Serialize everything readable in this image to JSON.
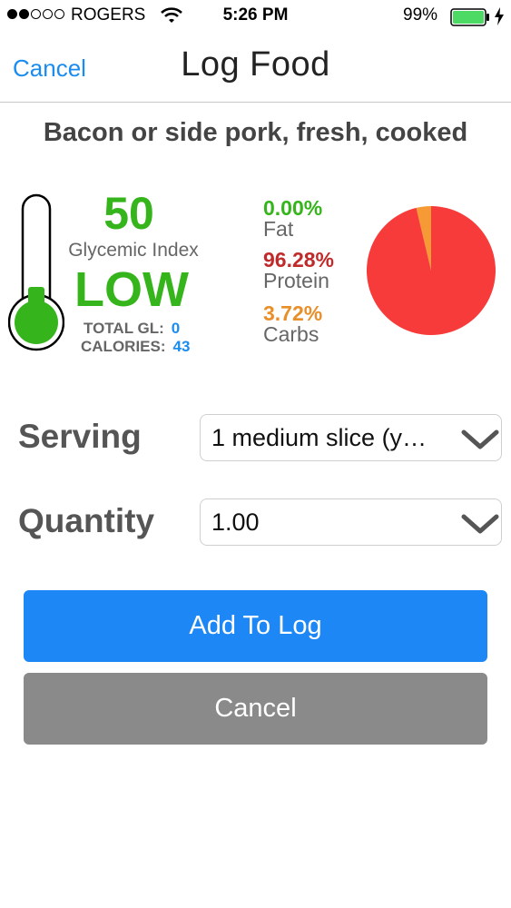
{
  "status_bar": {
    "carrier": "ROGERS",
    "time": "5:26 PM",
    "battery": "99%"
  },
  "nav": {
    "cancel_label": "Cancel",
    "title": "Log Food"
  },
  "food": {
    "name": "Bacon or side pork, fresh, cooked"
  },
  "glycemic": {
    "index": "50",
    "index_label": "Glycemic Index",
    "rating": "LOW",
    "total_gl_label": "TOTAL GL:",
    "total_gl": "0",
    "calories_label": "CALORIES:",
    "calories": "43"
  },
  "macros": {
    "fat_pct": "0.00%",
    "fat_label": "Fat",
    "protein_pct": "96.28%",
    "protein_label": "Protein",
    "carbs_pct": "3.72%",
    "carbs_label": "Carbs"
  },
  "chart_data": {
    "type": "pie",
    "categories": [
      "Fat",
      "Protein",
      "Carbs"
    ],
    "values": [
      0.0,
      96.28,
      3.72
    ],
    "colors": [
      "#35b51b",
      "#f73b3b",
      "#f59a35"
    ]
  },
  "form": {
    "serving_label": "Serving",
    "serving_value": "1 medium slice (y…",
    "quantity_label": "Quantity",
    "quantity_value": "1.00"
  },
  "buttons": {
    "add_label": "Add To Log",
    "cancel_label": "Cancel"
  },
  "colors": {
    "accent": "#1a8cf0",
    "green": "#35b51b",
    "protein_red": "#c02a2a",
    "carbs_orange": "#e88f2a",
    "pie_red": "#f73b3b",
    "pie_orange": "#f59a35",
    "cancel_gray": "#8a8a8a"
  },
  "icons": [
    "signal-icon",
    "wifi-icon",
    "battery-icon",
    "charging-bolt-icon",
    "thermometer-icon",
    "chevron-down-icon"
  ]
}
